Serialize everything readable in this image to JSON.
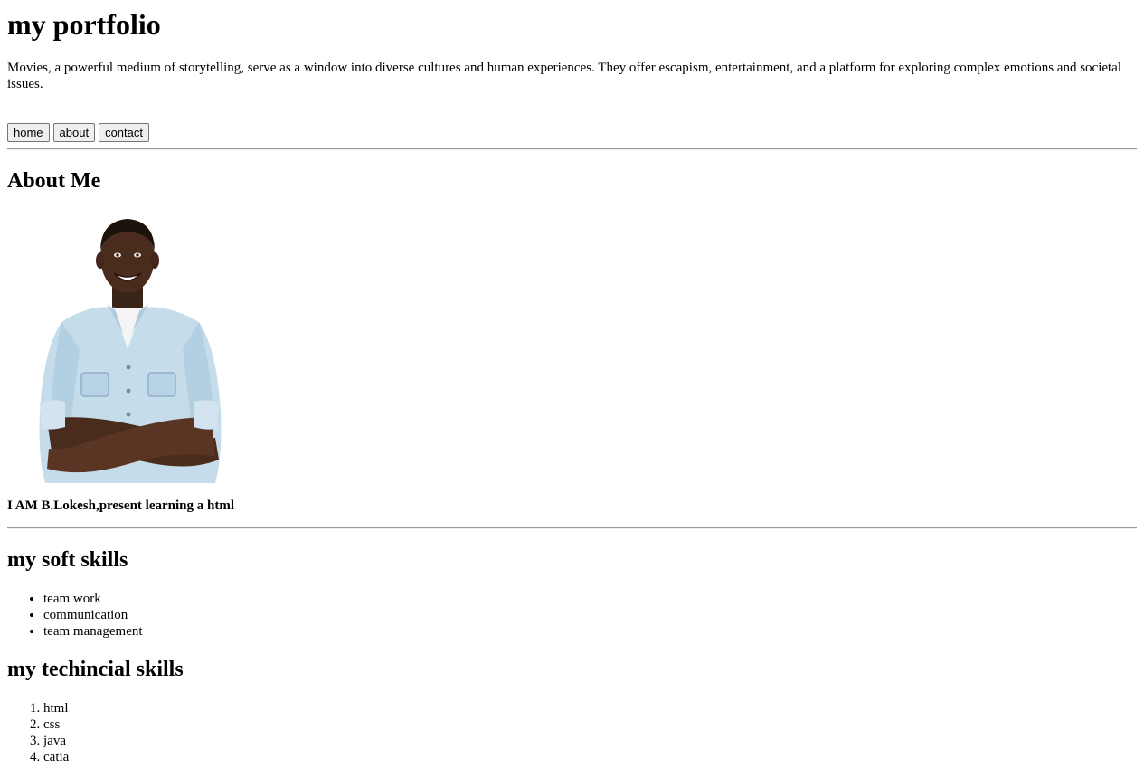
{
  "header": {
    "title": "my portfolio",
    "intro": "Movies, a powerful medium of storytelling, serve as a window into diverse cultures and human experiences. They offer escapism, entertainment, and a platform for exploring complex emotions and societal issues."
  },
  "nav": {
    "home_label": "home",
    "about_label": "about",
    "contact_label": "contact"
  },
  "about": {
    "heading": "About Me",
    "photo_alt": "portrait photo",
    "text": "I AM B.Lokesh,present learning a html"
  },
  "soft_skills": {
    "heading": "my soft skills",
    "items": [
      "team work",
      "communication",
      "team management"
    ]
  },
  "technical_skills": {
    "heading": "my techincial skills",
    "items": [
      "html",
      "css",
      "java",
      "catia"
    ]
  },
  "colors": {
    "divider": "#9a9a9a",
    "button_bg": "#efefef",
    "button_border": "#767676"
  }
}
